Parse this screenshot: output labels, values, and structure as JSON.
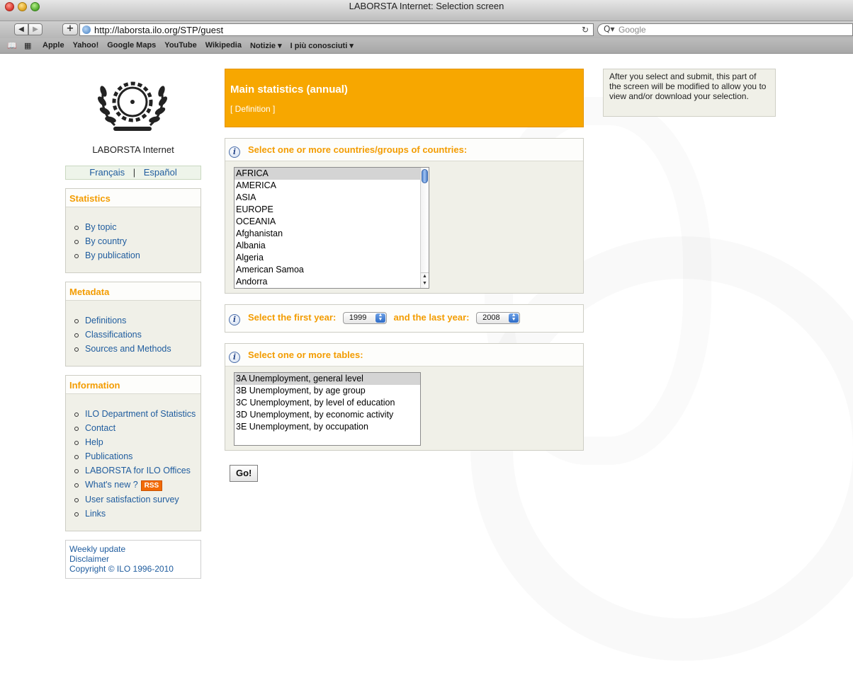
{
  "window": {
    "title": "LABORSTA Internet: Selection screen"
  },
  "toolbar": {
    "url": "http://laborsta.ilo.org/STP/guest",
    "search_placeholder": "Google"
  },
  "bookmarks": [
    "Apple",
    "Yahoo!",
    "Google Maps",
    "YouTube",
    "Wikipedia",
    "Notizie ▾",
    "I più conosciuti ▾"
  ],
  "sidebar": {
    "brand": "LABORSTA Internet",
    "lang_fr": "Français",
    "lang_sep": "|",
    "lang_es": "Español",
    "statistics": {
      "title": "Statistics",
      "items": [
        "By topic",
        "By country",
        "By publication"
      ]
    },
    "metadata": {
      "title": "Metadata",
      "items": [
        "Definitions",
        "Classifications",
        "Sources and Methods"
      ]
    },
    "information": {
      "title": "Information",
      "items": [
        "ILO Department of Statistics",
        "Contact",
        "Help",
        "Publications",
        "LABORSTA for ILO Offices",
        "What's new ?",
        "User satisfaction survey",
        "Links"
      ],
      "rss": "RSS"
    },
    "footer": [
      "Weekly update",
      "Disclaimer",
      "Copyright © ILO 1996-2010"
    ]
  },
  "main": {
    "title": "Main statistics (annual)",
    "definition_link": "[ Definition ]",
    "countries_label": "Select one or more countries/groups of countries:",
    "countries": [
      "AFRICA",
      "AMERICA",
      "ASIA",
      "EUROPE",
      "OCEANIA",
      "Afghanistan",
      "Albania",
      "Algeria",
      "American Samoa",
      "Andorra"
    ],
    "years_label_first": "Select the first year:",
    "first_year": "1999",
    "years_label_last": "and the last year:",
    "last_year": "2008",
    "tables_label": "Select one or more tables:",
    "tables": [
      "3A Unemployment, general level",
      "3B Unemployment, by age group",
      "3C Unemployment, by level of education",
      "3D Unemployment, by economic activity",
      "3E Unemployment, by occupation"
    ],
    "go_button": "Go!"
  },
  "note": "After you select and submit, this part of the screen will be modified to allow you to view and/or download your selection.",
  "colors": {
    "accent": "#f7a700",
    "heading": "#f39c00",
    "link": "#1f5c9e",
    "panel": "#f0f0e8"
  }
}
